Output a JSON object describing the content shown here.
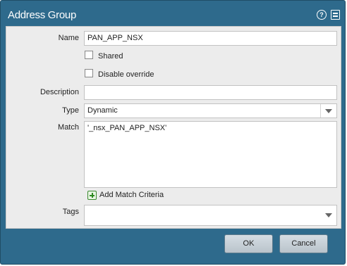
{
  "dialog": {
    "title": "Address Group",
    "help_icon": "help-icon",
    "form_icon": "form-icon"
  },
  "form": {
    "name_label": "Name",
    "name_value": "PAN_APP_NSX",
    "shared_label": "Shared",
    "shared_checked": false,
    "disable_override_label": "Disable override",
    "disable_override_checked": false,
    "description_label": "Description",
    "description_value": "",
    "type_label": "Type",
    "type_value": "Dynamic",
    "match_label": "Match",
    "match_value": "'_nsx_PAN_APP_NSX'",
    "add_match_label": "Add Match Criteria",
    "tags_label": "Tags",
    "tags_value": ""
  },
  "buttons": {
    "ok_label": "OK",
    "cancel_label": "Cancel"
  }
}
